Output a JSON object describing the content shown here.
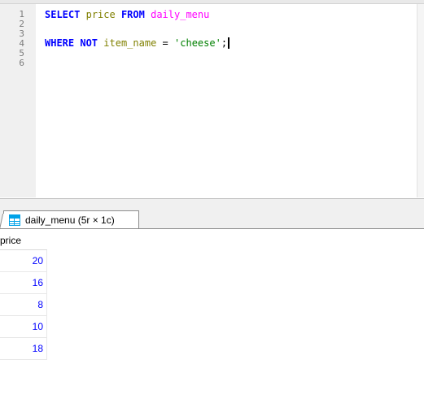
{
  "editor": {
    "line_numbers": [
      "1",
      "2",
      "3",
      "4",
      "5",
      "6"
    ],
    "line1": {
      "kw1": "SELECT",
      "col": "price",
      "kw2": "FROM",
      "table": "daily_menu"
    },
    "line3": {
      "kw1": "WHERE",
      "kw2": "NOT",
      "col": "item_name",
      "op": "=",
      "str": "'cheese'",
      "end": ";"
    }
  },
  "result_tab": {
    "label": "daily_menu (5r × 1c)"
  },
  "grid": {
    "column": "price",
    "rows": [
      "20",
      "16",
      "8",
      "10",
      "18"
    ]
  },
  "colors": {
    "keyword": "#0000ff",
    "identifier": "#808000",
    "table": "#ff00ff",
    "string": "#008000",
    "value": "#0000ff"
  }
}
